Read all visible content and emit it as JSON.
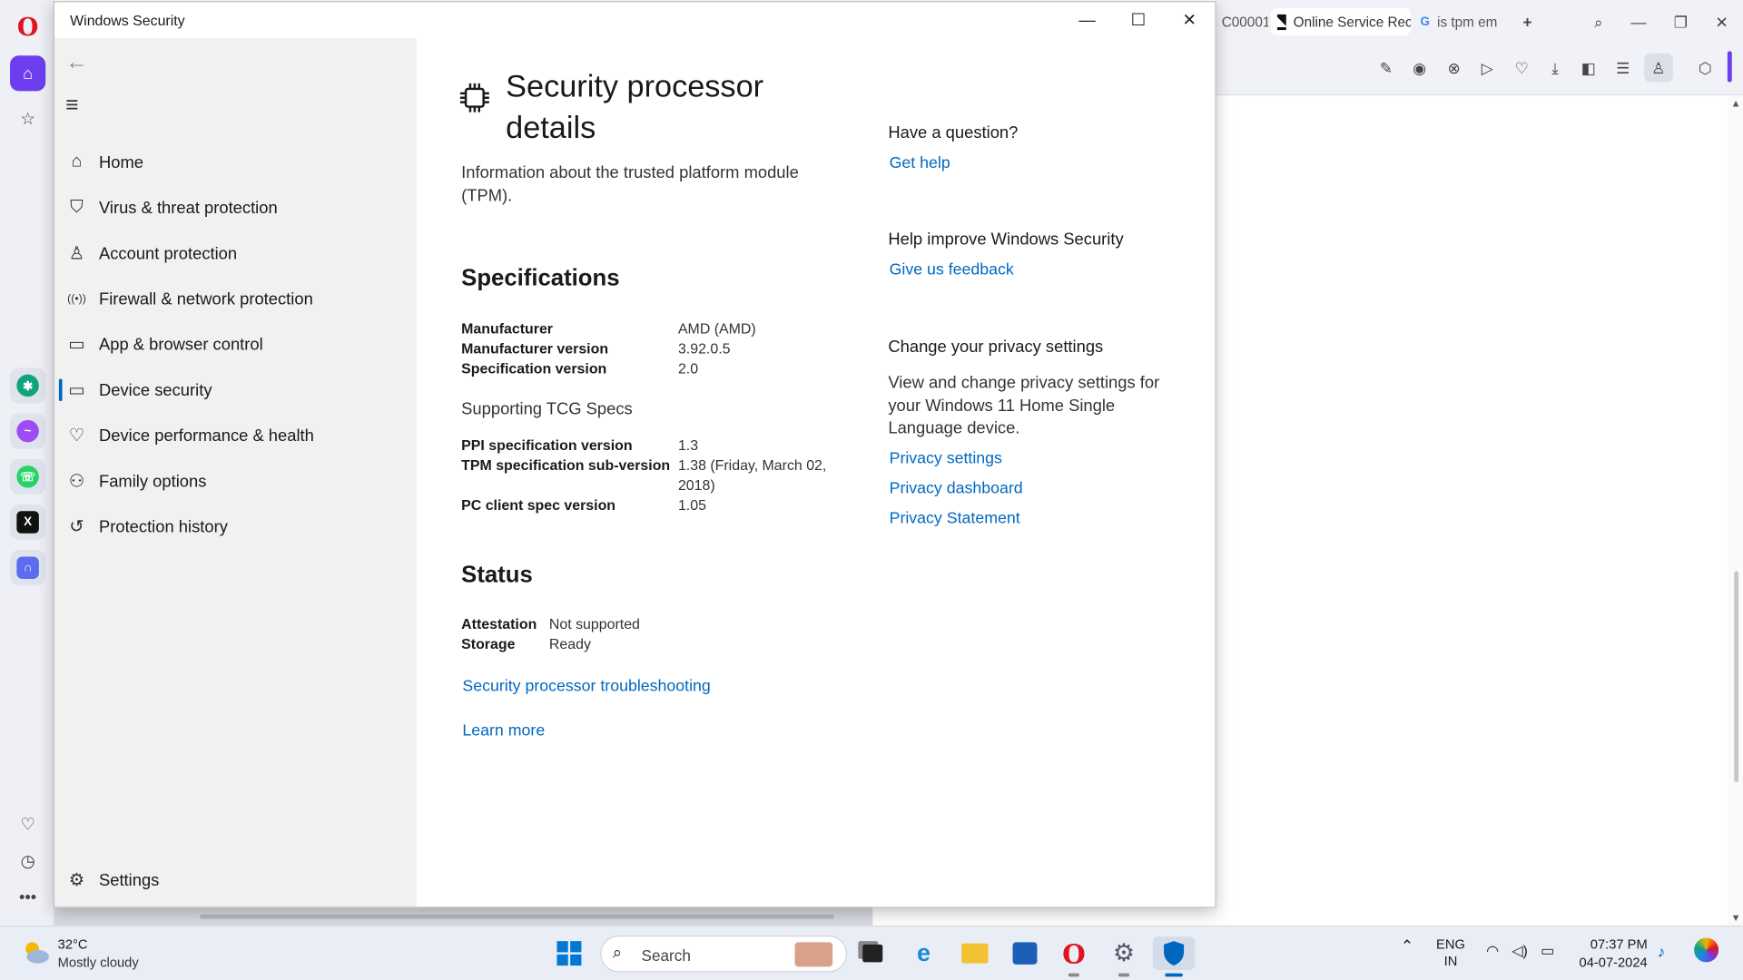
{
  "window": {
    "title": "Windows Security",
    "controls": {
      "minimize": "—",
      "maximize": "☐",
      "close": "✕"
    }
  },
  "nav": {
    "items": [
      {
        "label": "Home",
        "icon": "home-icon",
        "glyph": "⌂"
      },
      {
        "label": "Virus & threat protection",
        "icon": "shield-icon",
        "glyph": "⛉"
      },
      {
        "label": "Account protection",
        "icon": "person-icon",
        "glyph": "♙"
      },
      {
        "label": "Firewall & network protection",
        "icon": "antenna-icon",
        "glyph": "((•))"
      },
      {
        "label": "App & browser control",
        "icon": "browser-window-icon",
        "glyph": "▭"
      },
      {
        "label": "Device security",
        "icon": "laptop-icon",
        "glyph": "▭"
      },
      {
        "label": "Device performance & health",
        "icon": "heart-pulse-icon",
        "glyph": "♡"
      },
      {
        "label": "Family options",
        "icon": "family-icon",
        "glyph": "⚇"
      },
      {
        "label": "Protection history",
        "icon": "history-icon",
        "glyph": "↺"
      }
    ],
    "active_index": 5,
    "settings_label": "Settings"
  },
  "main": {
    "title": "Security processor details",
    "subtitle": "Information about the trusted platform module (TPM).",
    "specifications": {
      "heading": "Specifications",
      "rows": [
        {
          "key": "Manufacturer",
          "value": "AMD (AMD)"
        },
        {
          "key": "Manufacturer version",
          "value": "3.92.0.5"
        },
        {
          "key": "Specification version",
          "value": "2.0"
        }
      ],
      "tcg_heading": "Supporting TCG Specs",
      "tcg_rows": [
        {
          "key": "PPI specification version",
          "value": "1.3"
        },
        {
          "key": "TPM specification sub-version",
          "value": "1.38 (Friday, March 02, 2018)"
        },
        {
          "key": "PC client spec version",
          "value": "1.05"
        }
      ]
    },
    "status": {
      "heading": "Status",
      "rows": [
        {
          "key": "Attestation",
          "value": "Not supported"
        },
        {
          "key": "Storage",
          "value": "Ready"
        }
      ]
    },
    "links": {
      "troubleshooting": "Security processor troubleshooting",
      "learn_more": "Learn more"
    }
  },
  "side": {
    "question_heading": "Have a question?",
    "get_help": "Get help",
    "improve_heading": "Help improve Windows Security",
    "feedback": "Give us feedback",
    "privacy_heading": "Change your privacy settings",
    "privacy_text": "View and change privacy settings for your Windows 11 Home Single Language device.",
    "privacy_settings": "Privacy settings",
    "privacy_dashboard": "Privacy dashboard",
    "privacy_statement": "Privacy Statement"
  },
  "browser": {
    "tabs": [
      {
        "label": "C00001",
        "icon": ""
      },
      {
        "label": "Online Service Rec",
        "icon": "a"
      },
      {
        "label": "is tpm em",
        "icon": "G"
      }
    ]
  },
  "taskbar": {
    "weather_temp": "32°C",
    "weather_desc": "Mostly cloudy",
    "search_label": "Search",
    "lang_top": "ENG",
    "lang_bottom": "IN",
    "time": "07:37 PM",
    "date": "04-07-2024"
  },
  "colors": {
    "accent": "#0067c0",
    "nav_bg": "#f1f1f1",
    "opera_red": "#e0141e",
    "opera_home": "#6d3ef0"
  }
}
